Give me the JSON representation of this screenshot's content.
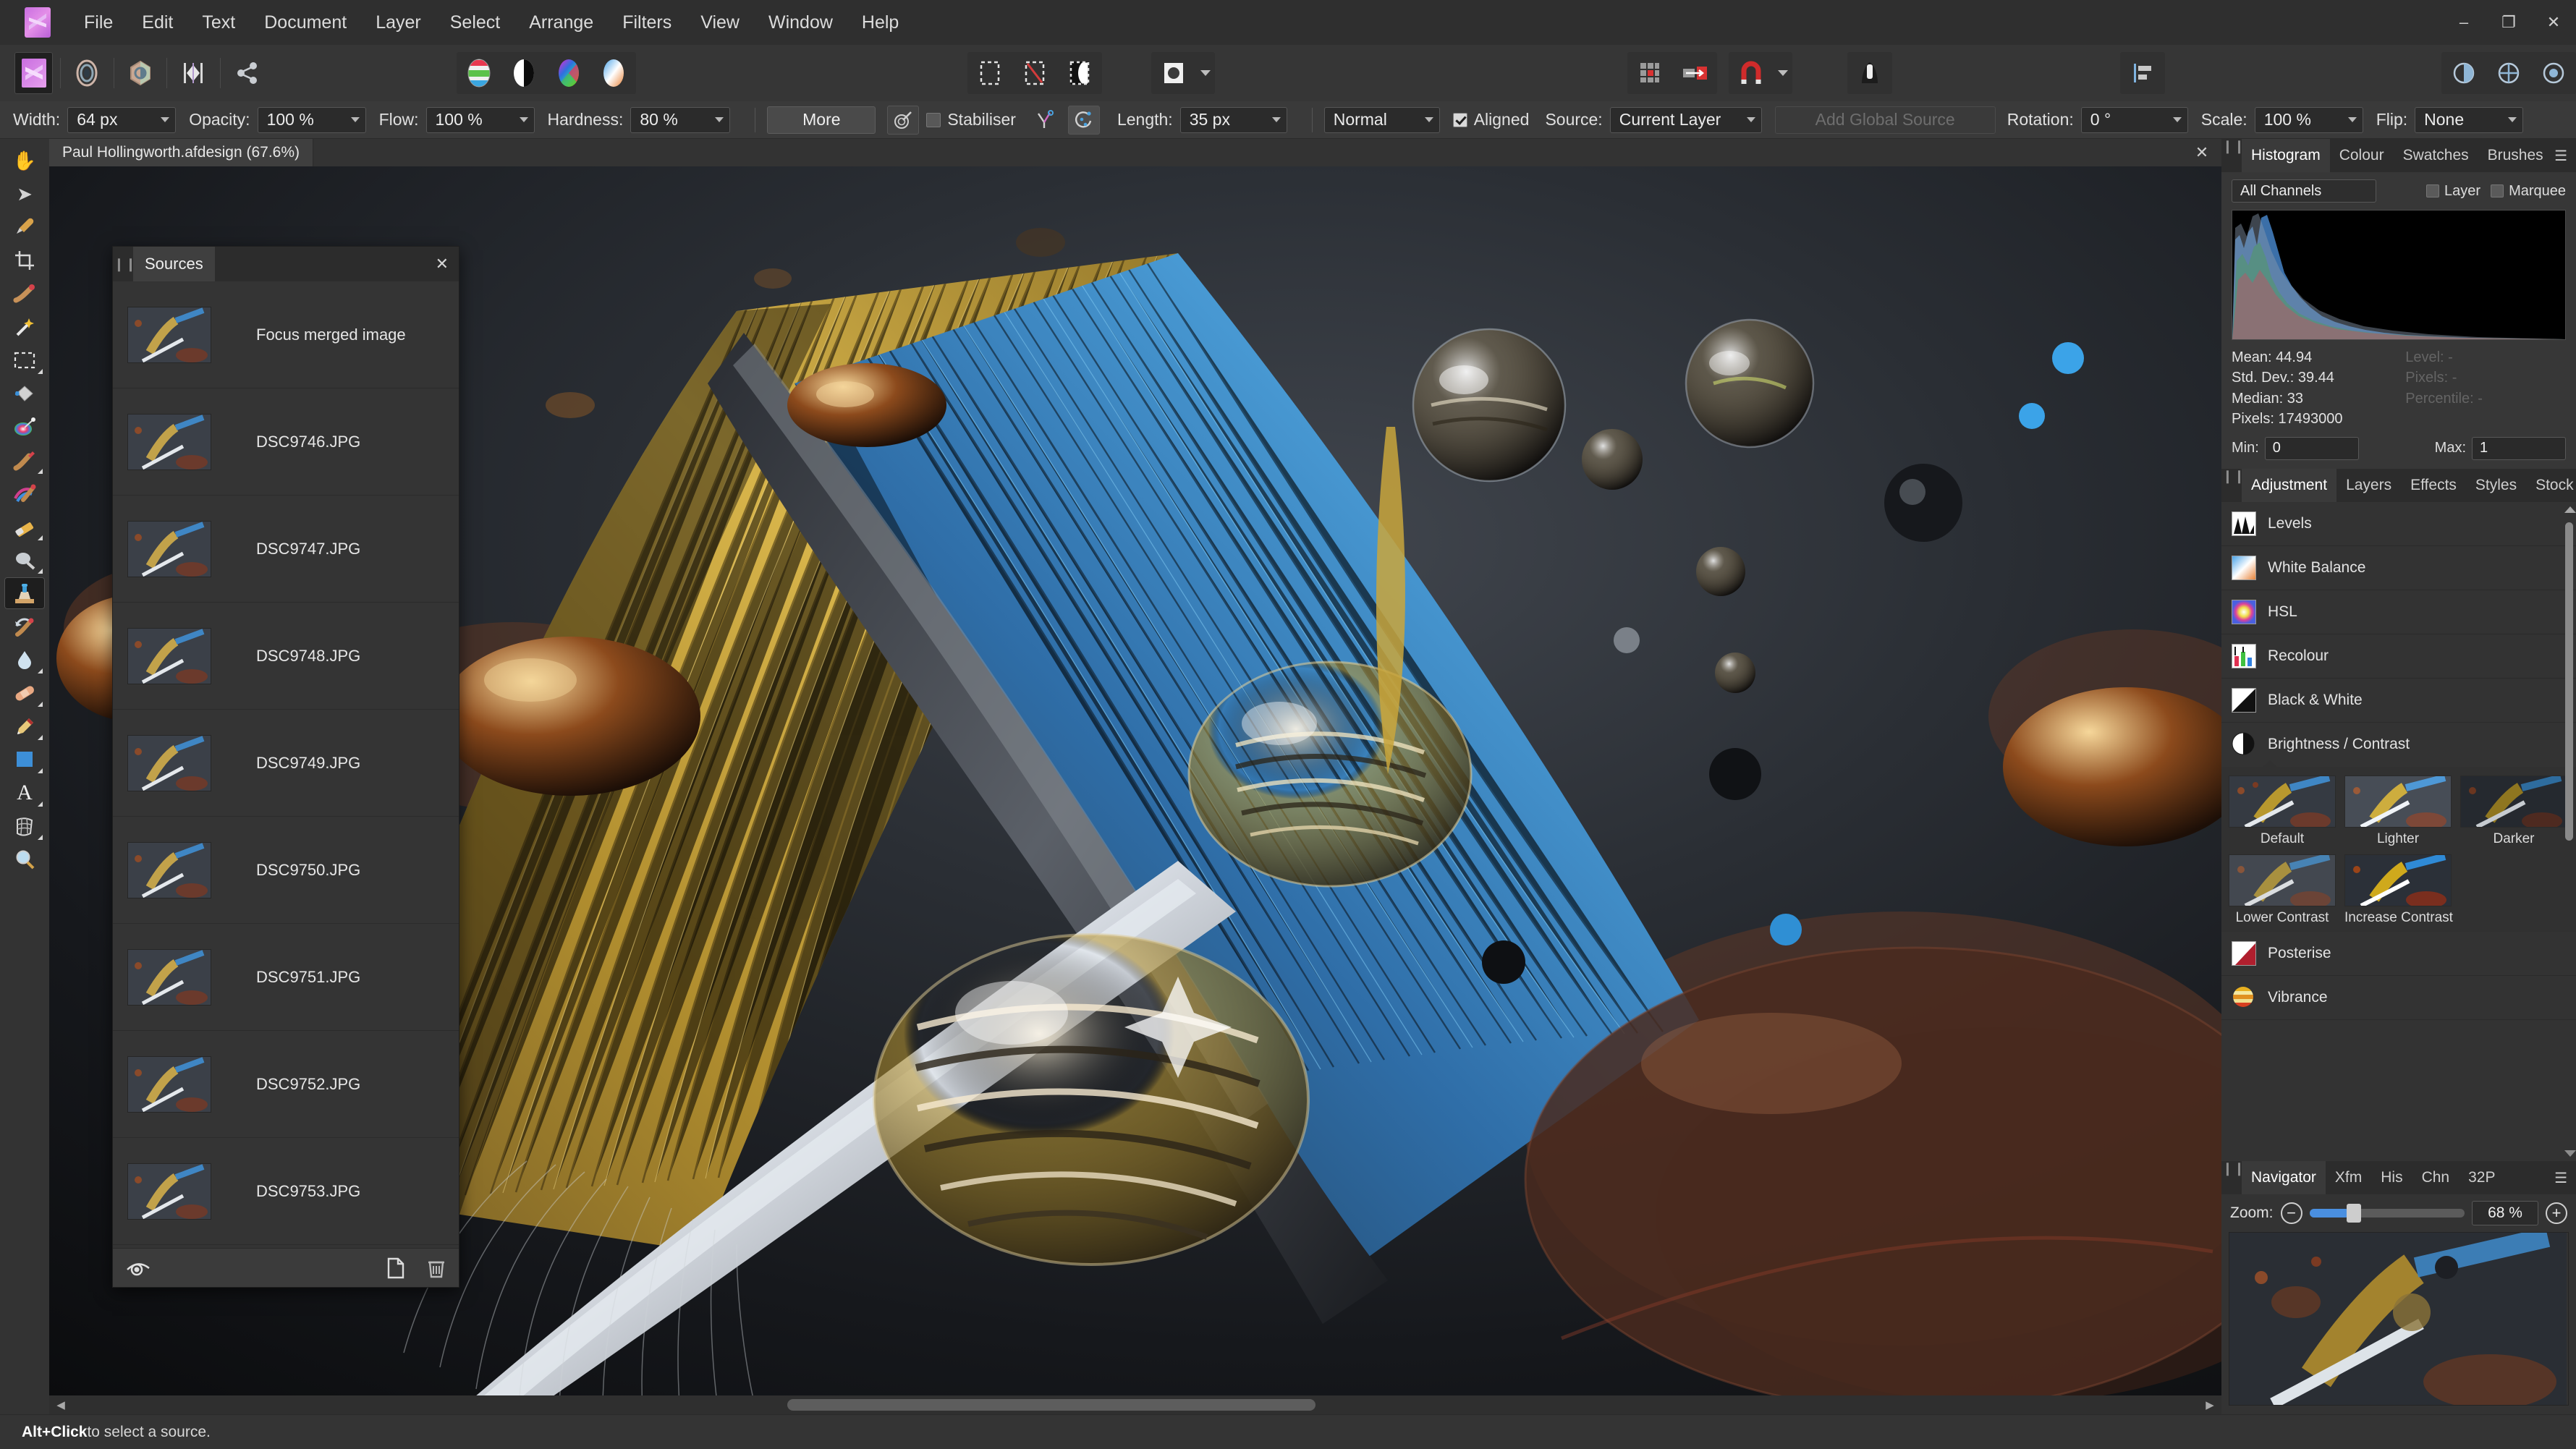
{
  "app": {
    "name": "Affinity Photo",
    "logo_icon": "affinity-logo-icon"
  },
  "menu": {
    "items": [
      "File",
      "Edit",
      "Text",
      "Document",
      "Layer",
      "Select",
      "Arrange",
      "Filters",
      "View",
      "Window",
      "Help"
    ]
  },
  "window_controls": {
    "minimize": "–",
    "maximize": "❐",
    "close": "✕"
  },
  "toolbar": {
    "groups": [
      {
        "buttons": [
          {
            "name": "persona-photo",
            "icon": "affinity-persona-icon",
            "active": true
          }
        ]
      },
      {
        "buttons": [
          {
            "name": "persona-liquify",
            "icon": "liquify-persona-icon",
            "active": false
          }
        ]
      },
      {
        "buttons": [
          {
            "name": "persona-develop",
            "icon": "develop-persona-icon",
            "active": false
          }
        ]
      },
      {
        "buttons": [
          {
            "name": "persona-tone-mapping",
            "icon": "tone-mapping-persona-icon",
            "active": false
          }
        ]
      },
      {
        "buttons": [
          {
            "name": "persona-export",
            "icon": "export-persona-icon",
            "active": false
          }
        ]
      }
    ],
    "colour_group": [
      "colour-picker-icon",
      "black-white-swatch-icon",
      "colour-wheel-icon",
      "gradient-swatch-icon"
    ],
    "selection_group": [
      "select-all-icon",
      "deselect-icon",
      "invert-selection-icon"
    ],
    "mask_group": [
      "refine-mask-icon"
    ],
    "snapping_group": [
      "grid-icon",
      "snap-to-icon",
      "magnet-icon"
    ],
    "assistant_group": [
      "assistant-icon"
    ],
    "view_group": [
      "split-view-icon",
      "mirror-view-icon",
      "before-after-icon"
    ],
    "align_group": [
      "align-icon"
    ]
  },
  "context_bar": {
    "width_label": "Width:",
    "width_value": "64 px",
    "opacity_label": "Opacity:",
    "opacity_value": "100 %",
    "flow_label": "Flow:",
    "flow_value": "100 %",
    "hardness_label": "Hardness:",
    "hardness_value": "80 %",
    "more_button": "More",
    "brush_preview_icon": "brush-dynamics-icon",
    "stabiliser_label": "Stabiliser",
    "stabiliser_checked": false,
    "rope_mode_icon": "rope-stabiliser-icon",
    "window_mode_icon": "window-stabiliser-icon",
    "length_label": "Length:",
    "length_value": "35 px",
    "blend_mode_value": "Normal",
    "aligned_label": "Aligned",
    "aligned_checked": true,
    "source_label": "Source:",
    "source_value": "Current Layer",
    "add_global_source": "Add Global Source",
    "rotation_label": "Rotation:",
    "rotation_value": "0 °",
    "scale_label": "Scale:",
    "scale_value": "100 %",
    "flip_label": "Flip:",
    "flip_value": "None"
  },
  "document": {
    "tab_title": "Paul Hollingworth.afdesign (67.6%)",
    "close_icon": "close-icon"
  },
  "tools": [
    {
      "name": "view-tool",
      "icon": "hand-icon",
      "active": false,
      "has_flyout": false
    },
    {
      "name": "move-tool",
      "icon": "arrow-cursor-icon",
      "active": false,
      "has_flyout": false
    },
    {
      "name": "colour-picker-tool",
      "icon": "eyedropper-icon",
      "active": false,
      "has_flyout": false
    },
    {
      "name": "crop-tool",
      "icon": "crop-icon",
      "active": false,
      "has_flyout": false
    },
    {
      "name": "selection-brush-tool",
      "icon": "selection-brush-icon",
      "active": false,
      "has_flyout": false
    },
    {
      "name": "flood-select-tool",
      "icon": "magic-wand-icon",
      "active": false,
      "has_flyout": false
    },
    {
      "name": "marquee-tool",
      "icon": "marquee-rect-icon",
      "active": false,
      "has_flyout": true
    },
    {
      "name": "flood-fill-tool",
      "icon": "paint-bucket-icon",
      "active": false,
      "has_flyout": false
    },
    {
      "name": "gradient-tool",
      "icon": "palette-icon",
      "active": false,
      "has_flyout": false
    },
    {
      "name": "paint-brush-tool",
      "icon": "paintbrush-icon",
      "active": false,
      "has_flyout": true
    },
    {
      "name": "paint-mixer-tool",
      "icon": "paint-mixer-icon",
      "active": false,
      "has_flyout": false
    },
    {
      "name": "erase-brush-tool",
      "icon": "eraser-icon",
      "active": false,
      "has_flyout": true
    },
    {
      "name": "dodge-burn-tool",
      "icon": "dodge-icon",
      "active": false,
      "has_flyout": true
    },
    {
      "name": "clone-brush-tool",
      "icon": "clone-stamp-icon",
      "active": true,
      "has_flyout": false
    },
    {
      "name": "undo-brush-tool",
      "icon": "undo-brush-icon",
      "active": false,
      "has_flyout": false
    },
    {
      "name": "blur-brush-tool",
      "icon": "water-drop-icon",
      "active": false,
      "has_flyout": true
    },
    {
      "name": "healing-brush-tool",
      "icon": "bandage-icon",
      "active": false,
      "has_flyout": true
    },
    {
      "name": "pen-tool",
      "icon": "fountain-pen-icon",
      "active": false,
      "has_flyout": true
    },
    {
      "name": "rectangle-tool",
      "icon": "blue-square-icon",
      "active": false,
      "has_flyout": true
    },
    {
      "name": "artistic-text-tool",
      "icon": "text-a-icon",
      "active": false,
      "has_flyout": true
    },
    {
      "name": "mesh-warp-tool",
      "icon": "mesh-warp-icon",
      "active": false,
      "has_flyout": true
    },
    {
      "name": "zoom-tool",
      "icon": "magnifier-icon",
      "active": false,
      "has_flyout": false
    }
  ],
  "sources_panel": {
    "title": "Sources",
    "grip_icon": "drag-grip-icon",
    "close_icon": "close-icon",
    "items": [
      {
        "name": "Focus merged image"
      },
      {
        "name": "DSC9746.JPG"
      },
      {
        "name": "DSC9747.JPG"
      },
      {
        "name": "DSC9748.JPG"
      },
      {
        "name": "DSC9749.JPG"
      },
      {
        "name": "DSC9750.JPG"
      },
      {
        "name": "DSC9751.JPG"
      },
      {
        "name": "DSC9752.JPG"
      },
      {
        "name": "DSC9753.JPG"
      }
    ],
    "footer": {
      "visibility_icon": "eye-icon",
      "add_icon": "new-document-icon",
      "delete_icon": "trash-icon"
    }
  },
  "histogram_panel": {
    "tabs": [
      "Histogram",
      "Colour",
      "Swatches",
      "Brushes"
    ],
    "active_tab": "Histogram",
    "menu_icon": "panel-menu-icon",
    "channel_select": "All Channels",
    "layer_checkbox": {
      "label": "Layer",
      "checked": false
    },
    "marquee_checkbox": {
      "label": "Marquee",
      "checked": false
    },
    "stats": {
      "mean": "Mean: 44.94",
      "std_dev": "Std. Dev.: 39.44",
      "median": "Median: 33",
      "pixels": "Pixels: 17493000",
      "level": "Level: -",
      "level_pixels": "Pixels: -",
      "percentile": "Percentile: -"
    },
    "min_label": "Min:",
    "min_value": "0",
    "max_label": "Max:",
    "max_value": "1"
  },
  "adjustment_panel": {
    "tabs": [
      "Adjustment",
      "Layers",
      "Effects",
      "Styles",
      "Stock"
    ],
    "active_tab": "Adjustment",
    "items": [
      {
        "label": "Levels",
        "icon": "levels-icon"
      },
      {
        "label": "White Balance",
        "icon": "white-balance-icon"
      },
      {
        "label": "HSL",
        "icon": "hsl-icon"
      },
      {
        "label": "Recolour",
        "icon": "recolour-icon"
      },
      {
        "label": "Black & White",
        "icon": "black-white-icon"
      },
      {
        "label": "Brightness / Contrast",
        "icon": "brightness-contrast-icon"
      }
    ],
    "expanded_item": "Brightness / Contrast",
    "presets": [
      "Default",
      "Lighter",
      "Darker",
      "Lower Contrast",
      "Increase Contrast"
    ],
    "items_after": [
      {
        "label": "Posterise",
        "icon": "posterise-icon"
      },
      {
        "label": "Vibrance",
        "icon": "vibrance-icon"
      }
    ]
  },
  "navigator_panel": {
    "tabs": [
      "Navigator",
      "Xfm",
      "His",
      "Chn",
      "32P"
    ],
    "active_tab": "Navigator",
    "menu_icon": "panel-menu-icon",
    "zoom_label": "Zoom:",
    "zoom_out_icon": "minus-circle-icon",
    "zoom_in_icon": "plus-circle-icon",
    "zoom_value": "68 %"
  },
  "status_bar": {
    "prefix": "Alt+Click",
    "text": " to select a source."
  },
  "colors": {
    "accent_blue": "#4a8fe0",
    "window_bg": "#2b2b2b",
    "panel_bg": "#333333",
    "toolbar_bg": "#363636"
  }
}
